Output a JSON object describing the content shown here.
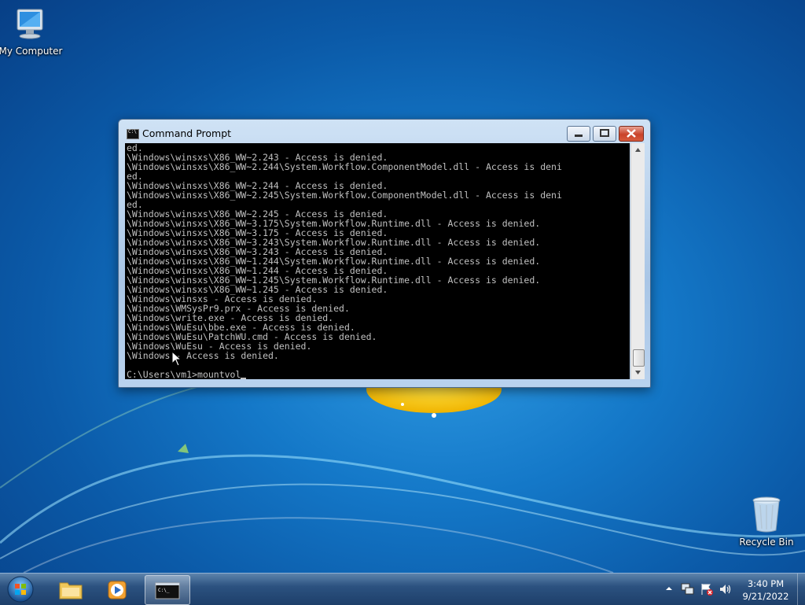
{
  "desktop": {
    "icons": [
      {
        "label": "My Computer",
        "icon": "computer-icon"
      },
      {
        "label": "Recycle Bin",
        "icon": "recycle-bin-icon"
      }
    ],
    "accent_color": "#1478c8"
  },
  "window": {
    "title": "Command Prompt",
    "controls": {
      "minimize": "minimize-icon",
      "maximize": "maximize-icon",
      "close": "close-icon"
    },
    "console_lines": [
      "ed.",
      "\\Windows\\winsxs\\X86_WW~2.243 - Access is denied.",
      "\\Windows\\winsxs\\X86_WW~2.244\\System.Workflow.ComponentModel.dll - Access is deni",
      "ed.",
      "\\Windows\\winsxs\\X86_WW~2.244 - Access is denied.",
      "\\Windows\\winsxs\\X86_WW~2.245\\System.Workflow.ComponentModel.dll - Access is deni",
      "ed.",
      "\\Windows\\winsxs\\X86_WW~2.245 - Access is denied.",
      "\\Windows\\winsxs\\X86_WW~3.175\\System.Workflow.Runtime.dll - Access is denied.",
      "\\Windows\\winsxs\\X86_WW~3.175 - Access is denied.",
      "\\Windows\\winsxs\\X86_WW~3.243\\System.Workflow.Runtime.dll - Access is denied.",
      "\\Windows\\winsxs\\X86_WW~3.243 - Access is denied.",
      "\\Windows\\winsxs\\X86_WW~1.244\\System.Workflow.Runtime.dll - Access is denied.",
      "\\Windows\\winsxs\\X86_WW~1.244 - Access is denied.",
      "\\Windows\\winsxs\\X86_WW~1.245\\System.Workflow.Runtime.dll - Access is denied.",
      "\\Windows\\winsxs\\X86_WW~1.245 - Access is denied.",
      "\\Windows\\winsxs - Access is denied.",
      "\\Windows\\WMSysPr9.prx - Access is denied.",
      "\\Windows\\write.exe - Access is denied.",
      "\\Windows\\WuEsu\\bbe.exe - Access is denied.",
      "\\Windows\\WuEsu\\PatchWU.cmd - Access is denied.",
      "\\Windows\\WuEsu - Access is denied.",
      "\\Windows - Access is denied."
    ],
    "prompt": "C:\\Users\\vm1>",
    "command_input": "mountvol"
  },
  "taskbar": {
    "pinned": [
      {
        "name": "explorer",
        "icon": "folder-icon"
      },
      {
        "name": "media-player",
        "icon": "media-player-icon"
      },
      {
        "name": "command-prompt",
        "icon": "cmd-icon",
        "active": true
      }
    ],
    "tray_icons": [
      "show-hidden-icons-icon",
      "network-icon",
      "action-center-icon",
      "volume-icon"
    ],
    "clock_time": "3:40 PM",
    "clock_date": "9/21/2022"
  }
}
